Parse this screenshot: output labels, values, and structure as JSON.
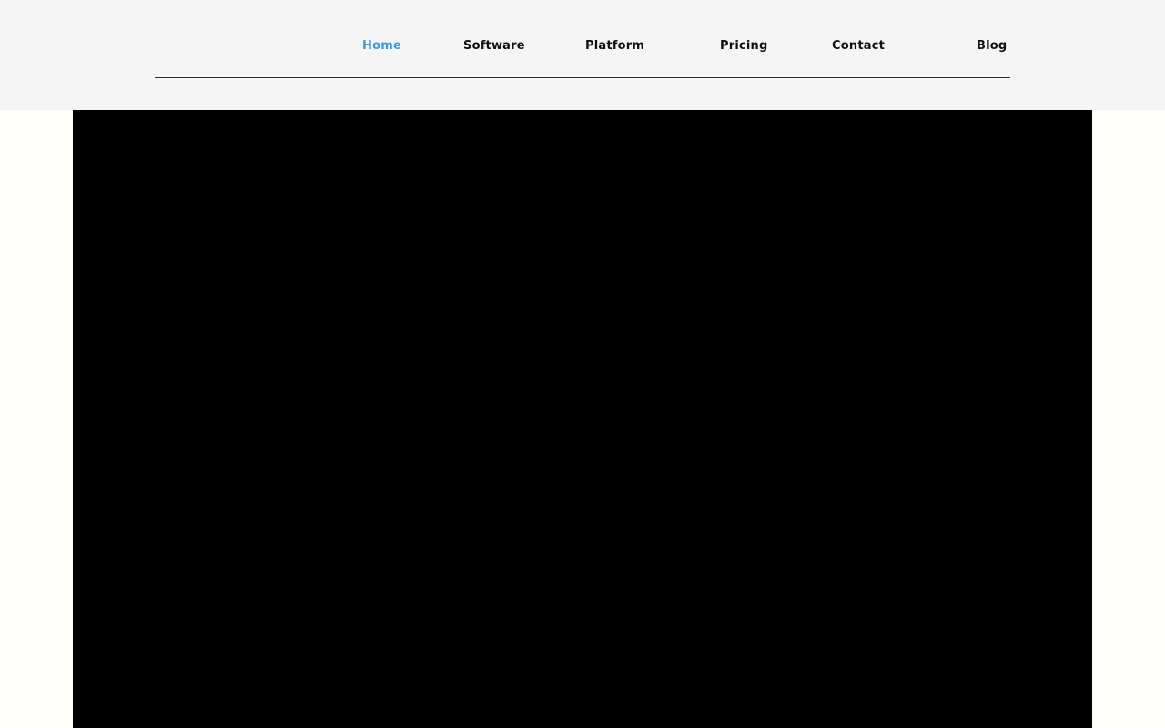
{
  "nav": {
    "items": [
      {
        "label": "Home",
        "active": true
      },
      {
        "label": "Software",
        "active": false
      },
      {
        "label": "Platform",
        "active": false
      },
      {
        "label": "Pricing",
        "active": false
      },
      {
        "label": "Contact",
        "active": false
      },
      {
        "label": "Blog",
        "active": false
      }
    ]
  },
  "colors": {
    "active_link": "#3d9be0",
    "link": "#111111",
    "header_bg": "#f5f5f5",
    "page_bg": "#fffdf7",
    "hero_bg": "#000000"
  }
}
